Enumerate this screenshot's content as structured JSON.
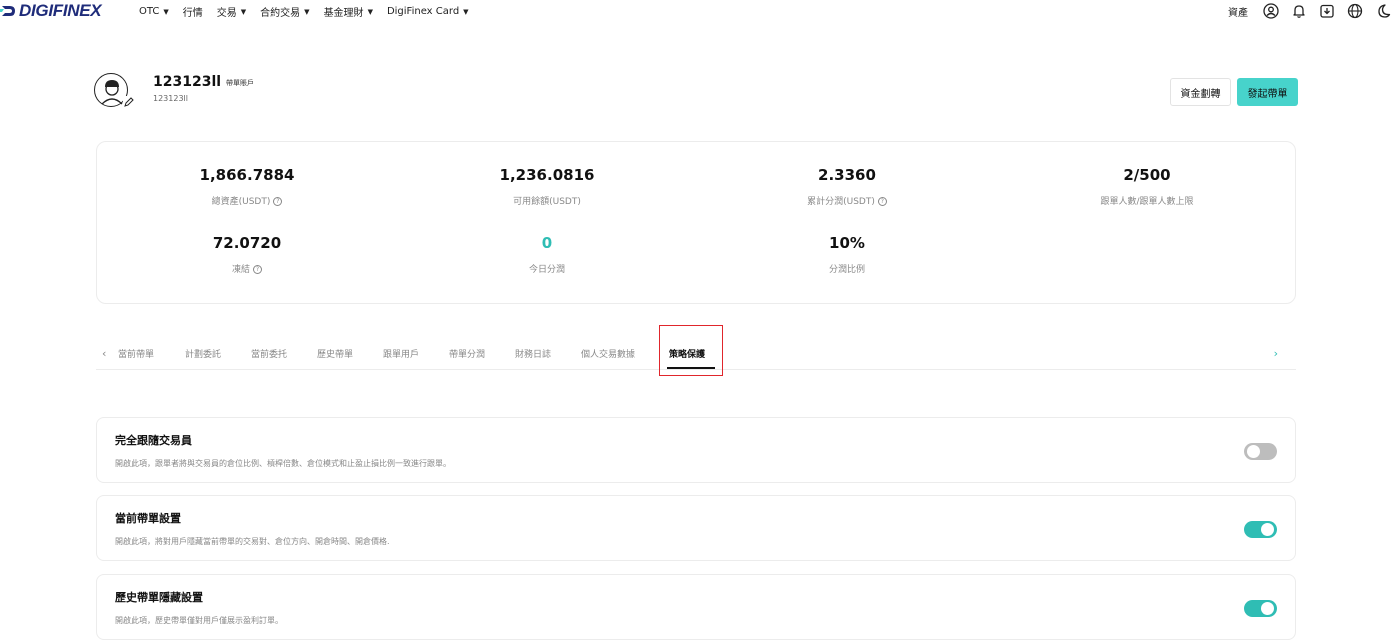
{
  "nav": {
    "logo_text": "DIGIFINEX",
    "items": [
      {
        "label": "OTC",
        "has_caret": true
      },
      {
        "label": "行情",
        "has_caret": false
      },
      {
        "label": "交易",
        "has_caret": true
      },
      {
        "label": "合約交易",
        "has_caret": true
      },
      {
        "label": "基金理財",
        "has_caret": true
      },
      {
        "label": "DigiFinex Card",
        "has_caret": true
      }
    ],
    "assets_label": "資產",
    "icons": [
      "user-icon",
      "bell-icon",
      "download-icon",
      "globe-icon",
      "moon-icon"
    ],
    "brand_color": "#1f2c7a"
  },
  "profile": {
    "username": "123123ll",
    "role_tag": "帶單賬戶",
    "user_id": "123123ll",
    "transfer_label": "資金劃轉",
    "start_label": "發起帶單",
    "accent_color": "#47d3cb"
  },
  "stats": [
    {
      "value": "1,866.7884",
      "label": "總資產(USDT)",
      "info": true
    },
    {
      "value": "1,236.0816",
      "label": "可用餘額(USDT)",
      "info": false
    },
    {
      "value": "2.3360",
      "label": "累計分潤(USDT)",
      "info": true
    },
    {
      "value": "2/500",
      "label": "跟單人數/跟單人數上限",
      "info": false
    },
    {
      "value": "72.0720",
      "label": "凍結",
      "info": true
    },
    {
      "value": "0",
      "label": "今日分潤",
      "info": false,
      "highlight": true
    },
    {
      "value": "10%",
      "label": "分潤比例",
      "info": false
    }
  ],
  "tabs": [
    {
      "label": "當前帶單"
    },
    {
      "label": "計劃委託"
    },
    {
      "label": "當前委托"
    },
    {
      "label": "歷史帶單"
    },
    {
      "label": "跟單用戶"
    },
    {
      "label": "帶單分潤"
    },
    {
      "label": "財務日誌"
    },
    {
      "label": "個人交易數據"
    },
    {
      "label": "策略保護",
      "active": true
    }
  ],
  "settings": [
    {
      "title": "完全跟隨交易員",
      "desc": "開啟此項，跟單者將與交易員的倉位比例、槓桿倍數、倉位模式和止盈止損比例一致進行跟單。",
      "enabled": false
    },
    {
      "title": "當前帶單設置",
      "desc": "開啟此項，將對用戶隱藏當前帶單的交易對、倉位方向、開倉時間、開倉價格.",
      "enabled": true
    },
    {
      "title": "歷史帶單隱藏設置",
      "desc": "開啟此項，歷史帶單僅對用戶僅展示盈利訂單。",
      "enabled": true
    }
  ],
  "colors": {
    "toggle_on": "#2fbdb4",
    "toggle_off": "#bdbdbd",
    "highlight_border": "#e0262c"
  }
}
